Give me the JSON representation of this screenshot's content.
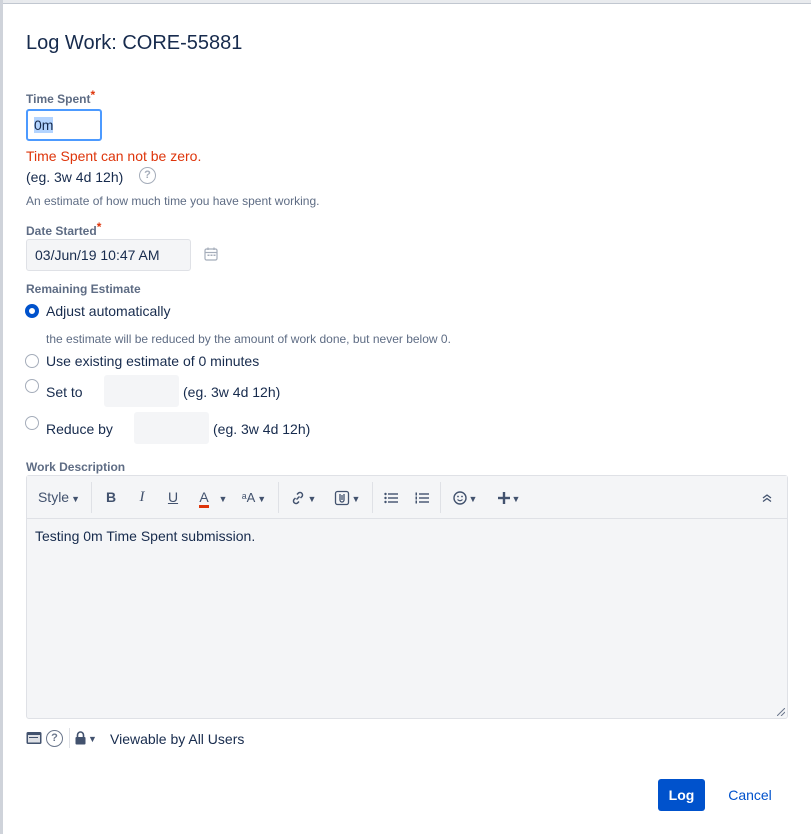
{
  "dialog": {
    "title": "Log Work: CORE-55881"
  },
  "time_spent": {
    "label": "Time Spent",
    "required_mark": "*",
    "value": "0m",
    "error": "Time Spent can not be zero.",
    "example": "(eg. 3w 4d 12h)",
    "help_glyph": "?",
    "hint": "An estimate of how much time you have spent working."
  },
  "date_started": {
    "label": "Date Started",
    "required_mark": "*",
    "value": "03/Jun/19 10:47 AM"
  },
  "remaining_estimate": {
    "label": "Remaining Estimate",
    "options": [
      {
        "label": "Adjust automatically",
        "checked": true,
        "description": "the estimate will be reduced by the amount of work done, but never below 0."
      },
      {
        "label": "Use existing estimate of 0 minutes",
        "checked": false
      },
      {
        "label": "Set to",
        "checked": false,
        "example": "(eg. 3w 4d 12h)"
      },
      {
        "label": "Reduce by",
        "checked": false,
        "example": "(eg. 3w 4d 12h)"
      }
    ]
  },
  "work_description": {
    "label": "Work Description",
    "toolbar": {
      "style_label": "Style",
      "bold": "B",
      "italic": "I",
      "underline": "U",
      "text_color": "A",
      "text_color_accent": "#de350b",
      "more_formatting": "ᵃA"
    },
    "text": "Testing 0m Time Spent submission."
  },
  "visibility": {
    "help_glyph": "?",
    "label": "Viewable by All Users"
  },
  "buttons": {
    "log": "Log",
    "cancel": "Cancel"
  },
  "colors": {
    "primary": "#0052cc",
    "error": "#de350b",
    "focus": "#4c9aff"
  }
}
